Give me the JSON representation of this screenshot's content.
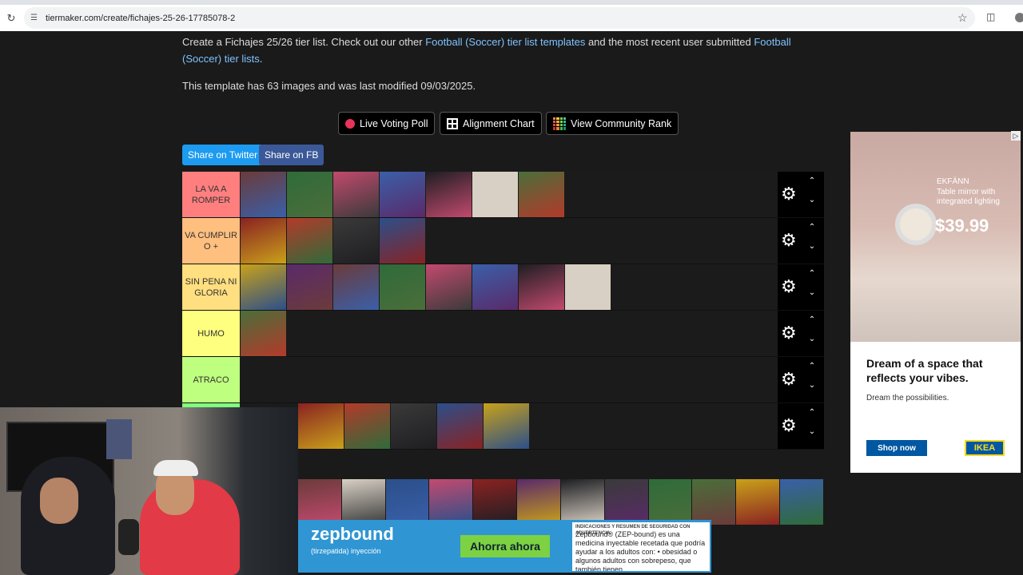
{
  "browser": {
    "url": "tiermaker.com/create/fichajes-25-26-17785078-2"
  },
  "page": {
    "desc_prefix": "Create a Fichajes 25/26 tier list. Check out our other ",
    "link1": "Football (Soccer) tier list templates",
    "desc_middle": " and the most recent user submitted ",
    "link2": "Football (Soccer) tier lists",
    "desc_suffix": ".",
    "modified": "This template has 63 images and was last modified 09/03/2025."
  },
  "buttons": {
    "live_voting": "Live Voting Poll",
    "alignment": "Alignment Chart",
    "community": "View Community Rank",
    "share_twitter": "Share on Twitter",
    "share_fb": "Share on FB"
  },
  "tiers": [
    {
      "label": "LA VA A ROMPER",
      "color": "#ff7f7f",
      "images": 7
    },
    {
      "label": "VA CUMPLIR O +",
      "color": "#ffbf7f",
      "images": 4
    },
    {
      "label": "SIN PENA NI GLORIA",
      "color": "#ffdf7f",
      "images": 8
    },
    {
      "label": "HUMO",
      "color": "#ffff7f",
      "images": 1
    },
    {
      "label": "ATRACO",
      "color": "#bfff7f",
      "images": 0
    },
    {
      "label": "",
      "color": "#7fff7f",
      "images": 5
    }
  ],
  "ad_ikea": {
    "brand": "EKFÄNN",
    "product": "Table mirror with integrated lighting",
    "price": "$39.99",
    "headline": "Dream of a space that reflects your vibes.",
    "tagline": "Dream the possibilities.",
    "cta": "Shop now",
    "logo": "IKEA"
  },
  "ad_zepbound": {
    "brand": "zepbound",
    "sub": "(tirzepatida) inyección",
    "cta": "Ahorra ahora",
    "info_title": "INDICACIONES Y RESUMEN DE SEGURIDAD CON ADVERTENCIA",
    "info_text": "Zepbound® (ZEP-bound) es una medicina inyectable recetada que podría ayudar a los adultos con: • obesidad o algunos adultos con sobrepeso, que también tienen"
  },
  "colors": {
    "tile_palette": [
      "#6b3b3b",
      "#2f6b3a",
      "#c24a6e",
      "#3a5fa8",
      "#1e1e22",
      "#d8d0c4",
      "#4a6e3a",
      "#8a2222",
      "#b33a2a",
      "#3a3a3a",
      "#2b4f8a",
      "#c9a11a",
      "#5a2a6a"
    ]
  }
}
